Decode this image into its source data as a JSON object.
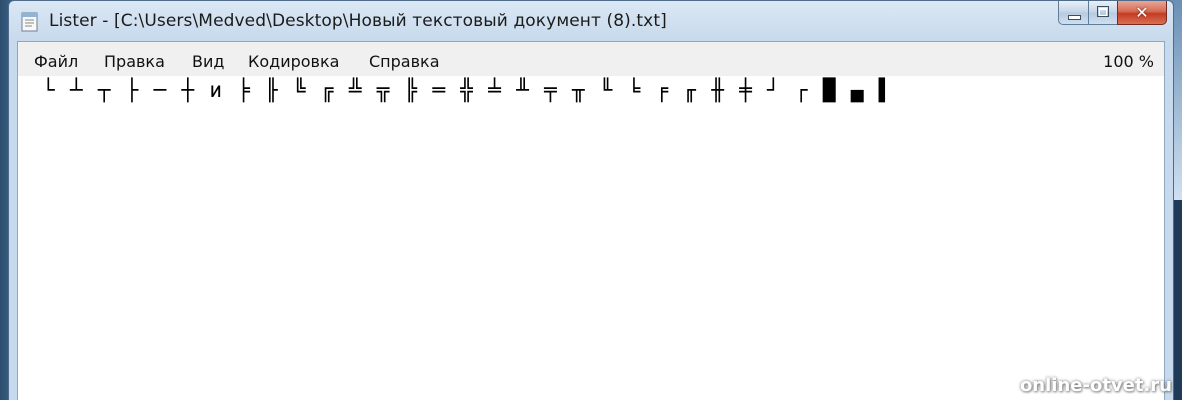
{
  "window": {
    "title": "Lister - [C:\\Users\\Medved\\Desktop\\Новый текстовый документ (8).txt]",
    "icon": "notepad-document-icon",
    "controls": {
      "minimize_icon": "minimize-icon",
      "maximize_icon": "maximize-icon",
      "close_label": "✕"
    }
  },
  "menubar": {
    "items": [
      "Файл",
      "Правка",
      "Вид",
      "Кодировка",
      "Справка"
    ],
    "zoom": "100 %"
  },
  "document": {
    "line1": "└ ┴ ┬ ├ ─ ┼ и ╞ ╟ ╚ ╔ ╩ ╦ ╠ ═ ╬ ╧ ╨ ╤ ╥ ╙ ╘ ╒ ╓ ╫ ╪ ┘ ┌ █ ▄ ▌"
  },
  "watermark": "online-otvet.ru",
  "colors": {
    "frame": "#c7d9ec",
    "close_button": "#c43b22",
    "menubar_bg": "#f0f0f0",
    "content_bg": "#ffffff"
  }
}
